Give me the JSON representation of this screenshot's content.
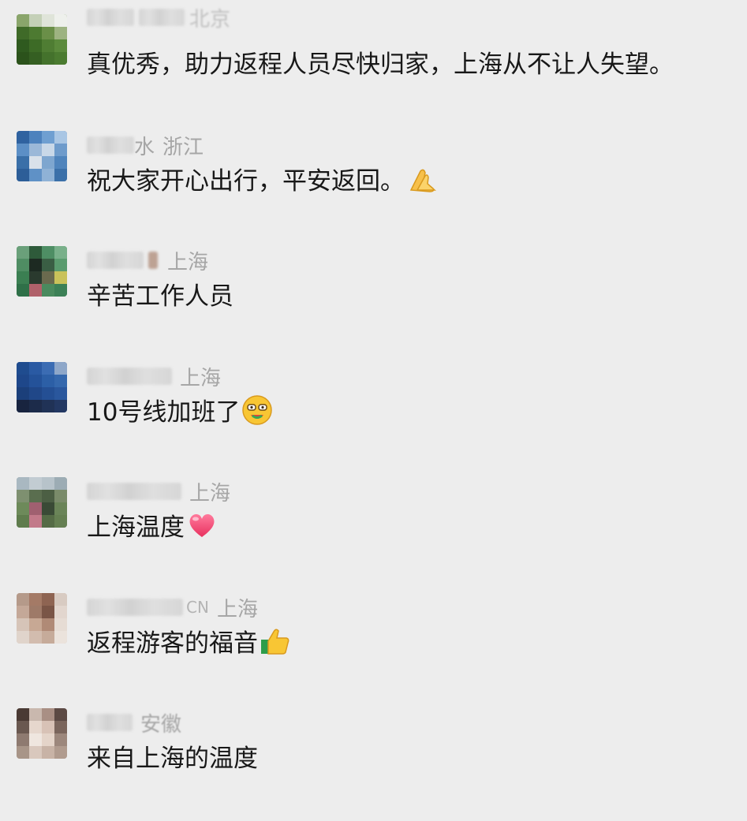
{
  "comments": [
    {
      "nickname_partial": "",
      "location": "北京",
      "text": "真优秀，助力返程人员尽快归家，上海从不让人失望。",
      "emoji": ""
    },
    {
      "nickname_partial": "水",
      "location": "浙江",
      "text": "祝大家开心出行，平安返回。",
      "emoji": "folded-hands-emoji"
    },
    {
      "nickname_partial": "",
      "location": "上海",
      "text": "辛苦工作人员",
      "emoji": ""
    },
    {
      "nickname_partial": "",
      "location": "上海",
      "text": "10号线加班了",
      "emoji": "yum-face-emoji"
    },
    {
      "nickname_partial": "",
      "location": "上海",
      "text": "上海温度",
      "emoji": "heart-emoji"
    },
    {
      "nickname_partial": "CN",
      "location": "上海",
      "text": "返程游客的福音",
      "emoji": "thumbs-up-emoji"
    },
    {
      "nickname_partial": "",
      "location": "安徽",
      "text": "来自上海的温度",
      "emoji": ""
    }
  ]
}
